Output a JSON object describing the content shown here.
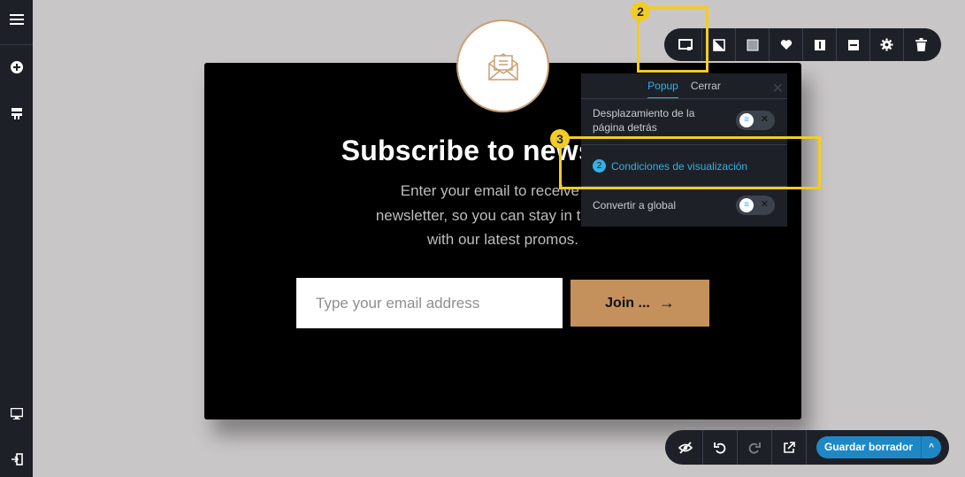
{
  "sidebar": {
    "icons": [
      "menu-icon",
      "add-icon",
      "structure-icon",
      "desktop-icon",
      "exit-icon"
    ]
  },
  "popup": {
    "headline": "Subscribe to newsletter",
    "subtext_lines": [
      "Enter your email to receive our",
      "newsletter, so you can stay in the loop",
      "with our latest promos."
    ],
    "email_placeholder": "Type your email address",
    "join_label": "Join ...",
    "join_arrow": "→"
  },
  "toolbar": {
    "icons": [
      "layout-icon",
      "contrast-icon",
      "square-icon",
      "heart-icon",
      "info-icon",
      "minus-icon",
      "gear-icon",
      "trash-icon"
    ]
  },
  "panel": {
    "tabs": [
      "Popup",
      "Cerrar"
    ],
    "active_tab": "Popup",
    "close_glyph": "✕",
    "page_scroll_label_line1": "Desplazamiento de la",
    "page_scroll_label_line2": "página detrás",
    "conditions_count": "2",
    "conditions_label": "Condiciones de visualización",
    "convert_global_label": "Convertir a global"
  },
  "highlights": {
    "badge_toolbar": "2",
    "badge_conditions": "3",
    "color": "#f2cc24"
  },
  "bottombar": {
    "icons": [
      "eye-off-icon",
      "undo-icon",
      "redo-icon",
      "external-link-icon"
    ],
    "save_label": "Guardar borrador",
    "save_caret": "^"
  },
  "colors": {
    "accent_gold": "#c4915c",
    "accent_blue": "#34b0e4",
    "save_blue": "#1e88c7",
    "ui_dark": "#1d2127"
  }
}
